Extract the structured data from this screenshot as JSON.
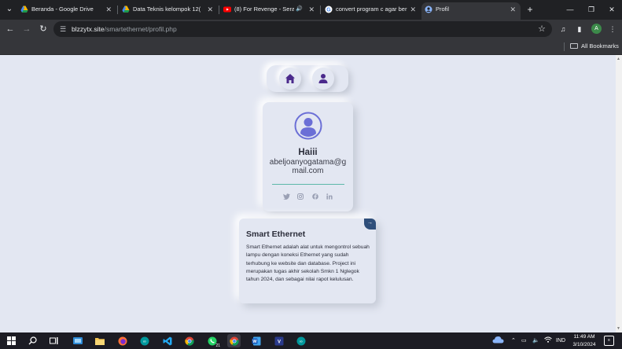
{
  "browser": {
    "tabs": [
      {
        "title": "Beranda - Google Drive",
        "close": "✕"
      },
      {
        "title": "Data Teknis kelompok 12(w",
        "close": "✕"
      },
      {
        "title": "(8) For Revenge - Seranı",
        "close": "✕",
        "audio": "🔊"
      },
      {
        "title": "convert program c agar ber",
        "close": "✕"
      },
      {
        "title": "Profil",
        "close": "✕"
      }
    ],
    "new_tab": "+",
    "window_controls": {
      "minimize": "—",
      "maximize": "❐",
      "close": "✕"
    },
    "url_host": "blzzytx.site",
    "url_path": "/smartethernet/profil.php",
    "profile_initial": "A",
    "bookmarks_label": "All Bookmarks"
  },
  "page": {
    "profile": {
      "name": "Haiii",
      "email": "abeljoanyogatama@gmail.com"
    },
    "info": {
      "title": "Smart Ethernet",
      "description": "Smart Ethernet adalah alat untuk mengontrol sebuah lampu dengan koneksi Ethernet yang sudah terhubung ke website dan database. Project ini merupakan tugas akhir sekolah Smkn 1 Nglegok tahun 2024, dan sebagai nilai rapot kelulusan.",
      "corner_label": "→"
    },
    "colors": {
      "accent": "#4b2a8c",
      "avatar": "#6b6fd6",
      "divider": "#5cb8a8",
      "corner": "#2e4e7a"
    }
  },
  "taskbar": {
    "whatsapp_badge": "21",
    "language": "IND",
    "time": "11:49 AM",
    "date": "3/10/2024"
  }
}
